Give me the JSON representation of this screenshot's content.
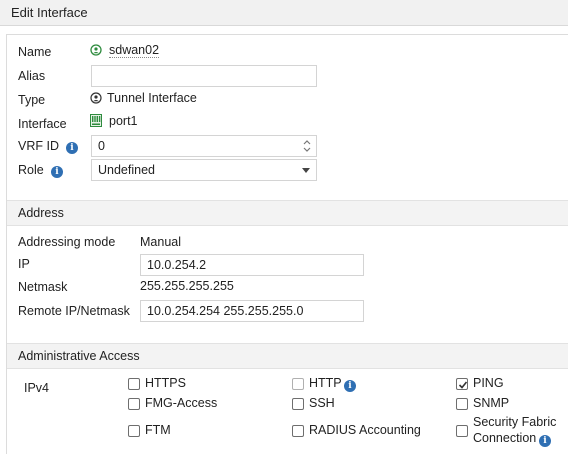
{
  "title": "Edit Interface",
  "form": {
    "name_label": "Name",
    "name_value": "sdwan02",
    "alias_label": "Alias",
    "alias_value": "",
    "type_label": "Type",
    "type_value": "Tunnel Interface",
    "interface_label": "Interface",
    "interface_value": "port1",
    "vrf_label": "VRF ID",
    "vrf_value": "0",
    "role_label": "Role",
    "role_value": "Undefined"
  },
  "address": {
    "heading": "Address",
    "mode_label": "Addressing mode",
    "mode_value": "Manual",
    "ip_label": "IP",
    "ip_value": "10.0.254.2",
    "netmask_label": "Netmask",
    "netmask_value": "255.255.255.255",
    "remote_label": "Remote IP/Netmask",
    "remote_value": "10.0.254.254 255.255.255.0"
  },
  "access": {
    "heading": "Administrative Access",
    "ipv4_label": "IPv4",
    "options": {
      "https": {
        "label": "HTTPS",
        "checked": false
      },
      "http": {
        "label": "HTTP",
        "checked": false,
        "disabled": true
      },
      "ping": {
        "label": "PING",
        "checked": true
      },
      "fmg": {
        "label": "FMG-Access",
        "checked": false
      },
      "ssh": {
        "label": "SSH",
        "checked": false
      },
      "snmp": {
        "label": "SNMP",
        "checked": false
      },
      "ftm": {
        "label": "FTM",
        "checked": false
      },
      "radius": {
        "label": "RADIUS Accounting",
        "checked": false
      },
      "fabric_line1": "Security Fabric",
      "fabric_line2": "Connection",
      "fabric_checked": false
    }
  },
  "icons": {
    "info_glyph": "i",
    "accent": "#2f6fb3",
    "status_green": "#2e8b3e"
  }
}
